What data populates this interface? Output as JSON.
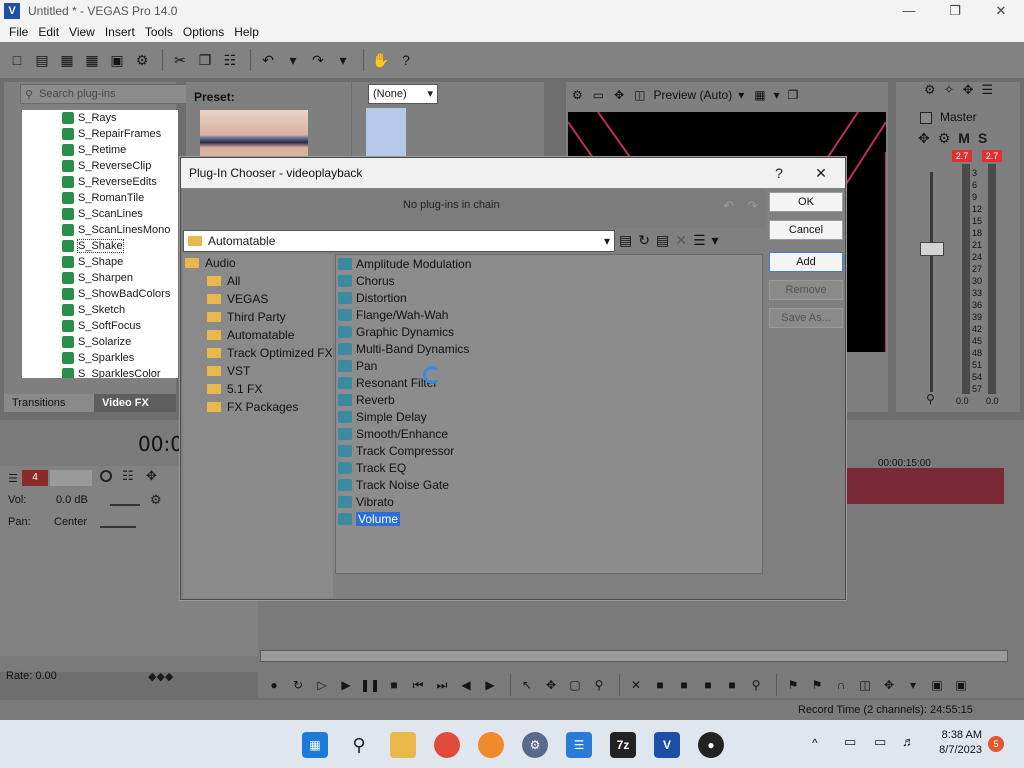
{
  "app": {
    "title": "Untitled * - VEGAS Pro 14.0",
    "logo": "V"
  },
  "window_controls": {
    "minimize": "—",
    "restore": "❐",
    "close": "✕"
  },
  "menu": [
    "File",
    "Edit",
    "View",
    "Insert",
    "Tools",
    "Options",
    "Help"
  ],
  "explorer": {
    "search_placeholder": "Search plug-ins",
    "items": [
      "S_Rays",
      "S_RepairFrames",
      "S_Retime",
      "S_ReverseClip",
      "S_ReverseEdits",
      "S_RomanTile",
      "S_ScanLines",
      "S_ScanLinesMono",
      "S_Shake",
      "S_Shape",
      "S_Sharpen",
      "S_ShowBadColors",
      "S_Sketch",
      "S_SoftFocus",
      "S_Solarize",
      "S_Sparkles",
      "S_SparklesColor"
    ],
    "selected_item": "S_Shake",
    "tabs": [
      "Transitions",
      "Video FX"
    ],
    "active_tab": "Video FX"
  },
  "preset": {
    "label": "Preset:"
  },
  "transition": {
    "none_value": "(None)"
  },
  "preview": {
    "mode": "Preview (Auto)"
  },
  "master": {
    "label": "Master",
    "mute": "M",
    "solo": "S",
    "peak_left": "2.7",
    "peak_right": "2.7",
    "scale": [
      "3",
      "6",
      "9",
      "12",
      "15",
      "18",
      "21",
      "24",
      "27",
      "30",
      "33",
      "36",
      "39",
      "42",
      "45",
      "48",
      "51",
      "54",
      "57"
    ],
    "val_left": "0.0",
    "val_right": "0.0"
  },
  "timeline": {
    "time": "00:0",
    "ruler_label": "00:00:15:00",
    "track_number": "4",
    "vol_label": "Vol:",
    "vol_value": "0.0 dB",
    "pan_label": "Pan:",
    "pan_value": "Center",
    "rate": "Rate: 0.00",
    "record_time": "Record Time (2 channels): 24:55:15"
  },
  "dialog": {
    "title": "Plug-In Chooser - videoplayback",
    "help": "?",
    "close": "✕",
    "chain_text": "No plug-ins in chain",
    "category": "Automatable",
    "tree": [
      {
        "label": "Audio",
        "level": 0
      },
      {
        "label": "All",
        "level": 1
      },
      {
        "label": "VEGAS",
        "level": 1
      },
      {
        "label": "Third Party",
        "level": 1
      },
      {
        "label": "Automatable",
        "level": 1
      },
      {
        "label": "Track Optimized FX",
        "level": 1
      },
      {
        "label": "VST",
        "level": 1
      },
      {
        "label": "5.1 FX",
        "level": 1
      },
      {
        "label": "FX Packages",
        "level": 1
      }
    ],
    "plugins": [
      "Amplitude Modulation",
      "Chorus",
      "Distortion",
      "Flange/Wah-Wah",
      "Graphic Dynamics",
      "Multi-Band Dynamics",
      "Pan",
      "Resonant Filter",
      "Reverb",
      "Simple Delay",
      "Smooth/Enhance",
      "Track Compressor",
      "Track EQ",
      "Track Noise Gate",
      "Vibrato",
      "Volume"
    ],
    "selected_plugin": "Volume",
    "buttons": {
      "ok": "OK",
      "cancel": "Cancel",
      "add": "Add",
      "remove": "Remove",
      "save_as": "Save As..."
    }
  },
  "taskbar": {
    "time": "8:38 AM",
    "date": "8/7/2023",
    "badge": "5"
  },
  "colors": {
    "accent": "#2b6fd4",
    "waveform": "#7a2a36",
    "peak": "#e03030"
  }
}
